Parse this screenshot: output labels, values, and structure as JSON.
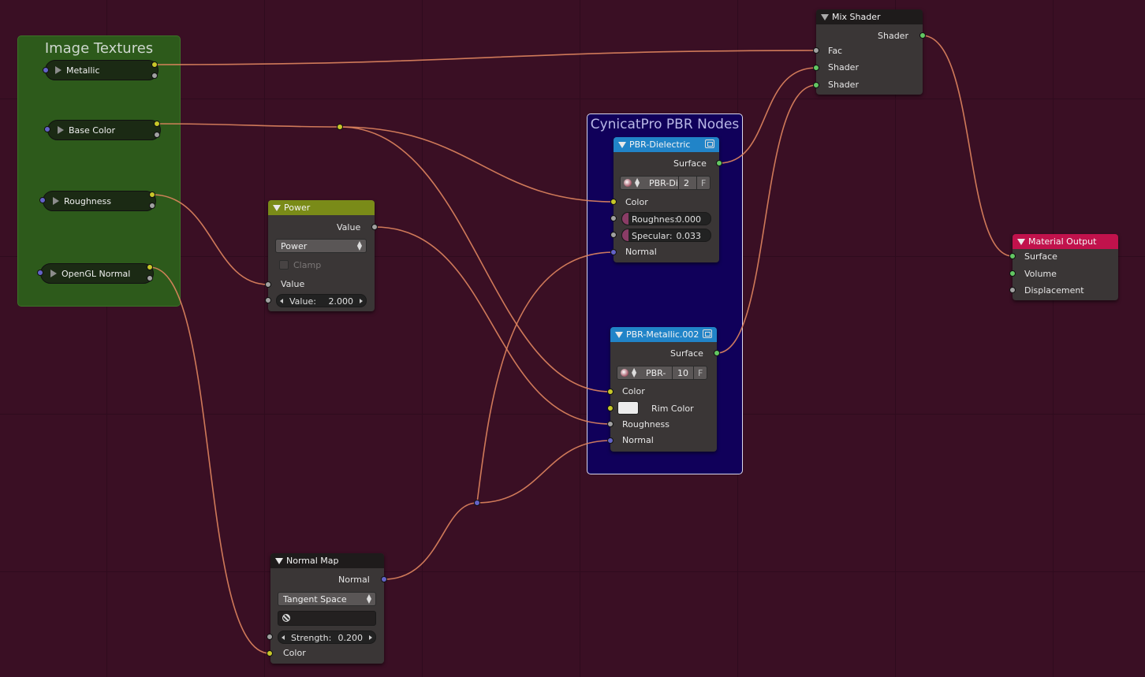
{
  "editor": {
    "background": "#3a0f24",
    "link_color": "#e0855f",
    "socket_colors": {
      "color": "#c7c729",
      "shader": "#63c763",
      "value": "#a1a1a1",
      "vector": "#6363c7"
    }
  },
  "frames": {
    "image_textures": {
      "label": "Image Textures",
      "color": "#2d5a1b"
    },
    "pbr_nodes": {
      "label": "CynicatPro PBR Nodes",
      "color": "#10005a"
    }
  },
  "textures": [
    {
      "label": "Metallic"
    },
    {
      "label": "Base Color"
    },
    {
      "label": "Roughness"
    },
    {
      "label": "OpenGL Normal"
    }
  ],
  "power": {
    "title": "Power",
    "header_color": "#7a8b18",
    "out_value": "Value",
    "operation": "Power",
    "clamp": "Clamp",
    "clamp_checked": false,
    "in_value": "Value",
    "value_field": {
      "label": "Value:",
      "value": "2.000"
    }
  },
  "normal_map": {
    "title": "Normal Map",
    "header_color": "#1e1b1b",
    "out_normal": "Normal",
    "space": "Tangent Space",
    "strength": {
      "label": "Strength:",
      "value": "0.200"
    },
    "in_color": "Color"
  },
  "pbr_dielectric": {
    "title": "PBR-Dielectric",
    "header_color": "#2184c8",
    "out_surface": "Surface",
    "group": {
      "name": "PBR-Di",
      "users": "2",
      "fake": "F"
    },
    "color": "Color",
    "roughness": {
      "label": "Roughnes:",
      "value": "0.000"
    },
    "specular": {
      "label": "Specular:",
      "value": "0.033"
    },
    "normal": "Normal"
  },
  "pbr_metallic": {
    "title": "PBR-Metallic.002",
    "header_color": "#2184c8",
    "out_surface": "Surface",
    "group": {
      "name": "PBR-",
      "users": "10",
      "fake": "F"
    },
    "color": "Color",
    "rim_color": "Rim Color",
    "roughness": "Roughness",
    "normal": "Normal"
  },
  "mix_shader": {
    "title": "Mix Shader",
    "header_color": "#1e1b1b",
    "out_shader": "Shader",
    "fac": "Fac",
    "shader1": "Shader",
    "shader2": "Shader"
  },
  "material_output": {
    "title": "Material Output",
    "header_color": "#c1124c",
    "surface": "Surface",
    "volume": "Volume",
    "displacement": "Displacement"
  }
}
